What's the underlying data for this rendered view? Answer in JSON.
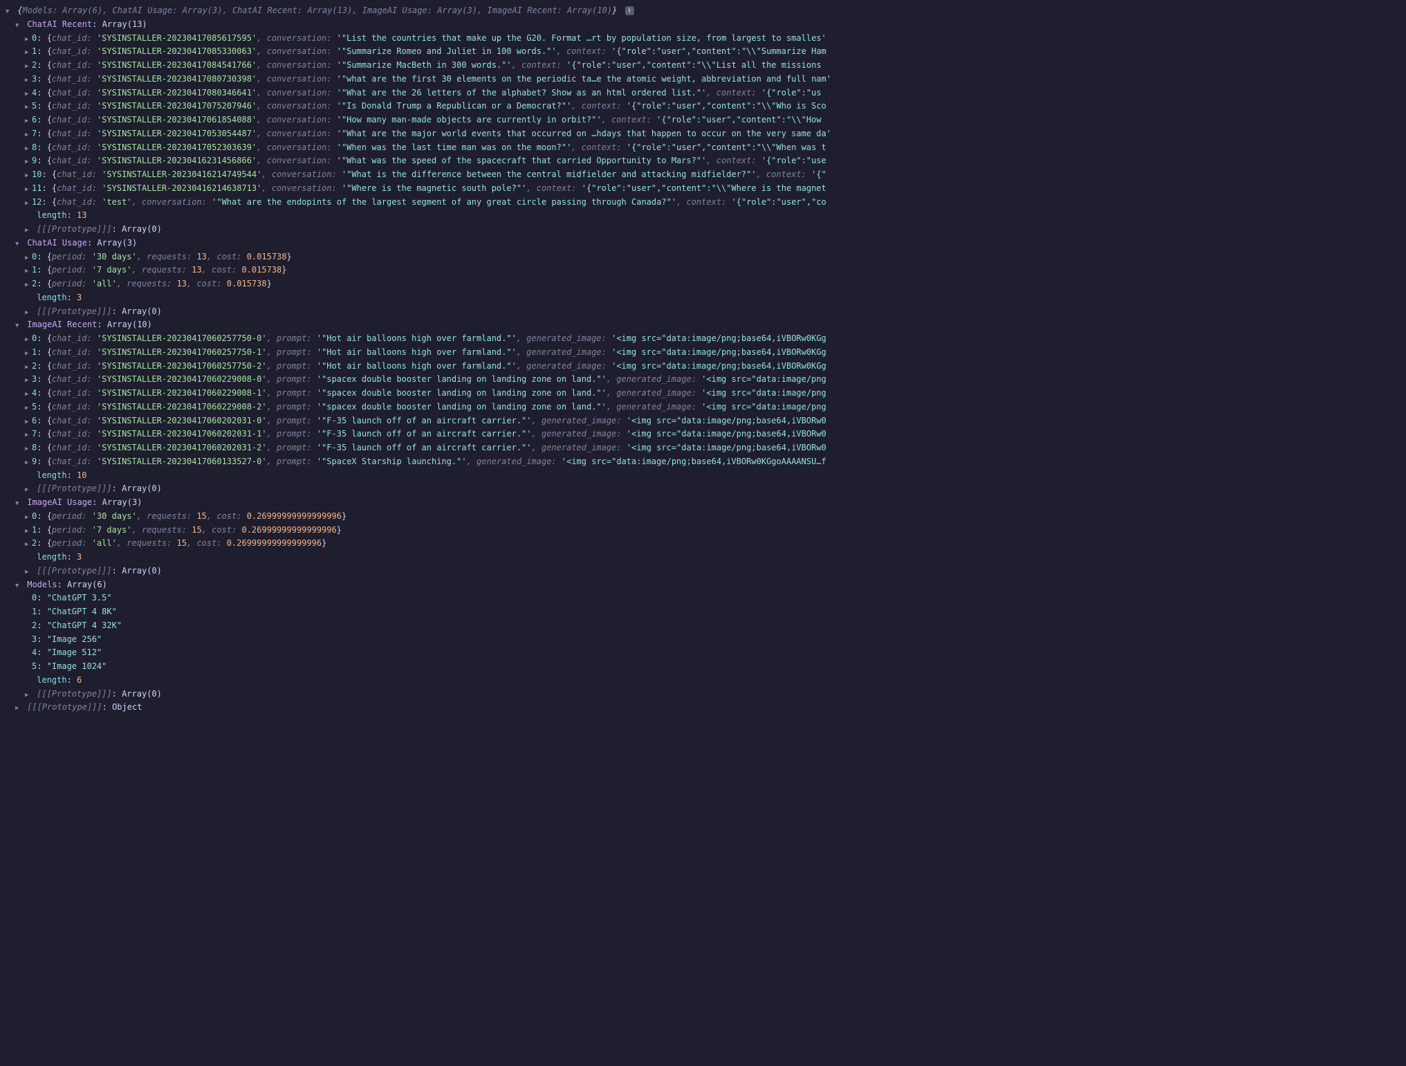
{
  "root_summary": {
    "keys": [
      {
        "k": "Models",
        "v": "Array(6)"
      },
      {
        "k": "ChatAI Usage",
        "v": "Array(3)"
      },
      {
        "k": "ChatAI Recent",
        "v": "Array(13)"
      },
      {
        "k": "ImageAI Usage",
        "v": "Array(3)"
      },
      {
        "k": "ImageAI Recent",
        "v": "Array(10)"
      }
    ]
  },
  "sections": {
    "chat_recent": {
      "title": "ChatAI Recent",
      "len": 13,
      "proto": "Array(0)"
    },
    "chat_usage": {
      "title": "ChatAI Usage",
      "len": 3,
      "proto": "Array(0)"
    },
    "img_recent": {
      "title": "ImageAI Recent",
      "len": 10,
      "proto": "Array(0)"
    },
    "img_usage": {
      "title": "ImageAI Usage",
      "len": 3,
      "proto": "Array(0)"
    },
    "models": {
      "title": "Models",
      "len": 6,
      "proto": "Array(0)"
    },
    "root_proto": "Object"
  },
  "chat_recent": [
    {
      "id": "SYSINSTALLER-20230417085617595",
      "conv": "\"List the countries that make up the G20.  Format …rt by population size, from largest to smalles",
      "ctx": ""
    },
    {
      "id": "SYSINSTALLER-20230417085330063",
      "conv": "\"Summarize Romeo and Juliet in 100 words.\"",
      "ctx": "'{\"role\":\"user\",\"content\":\"\\\\\"Summarize Ham"
    },
    {
      "id": "SYSINSTALLER-20230417084541766",
      "conv": "\"Summarize MacBeth in 300 words.\"",
      "ctx": "'{\"role\":\"user\",\"content\":\"\\\\\"List all the missions"
    },
    {
      "id": "SYSINSTALLER-20230417080730398",
      "conv": "\"what are the first 30 elements on the periodic ta…e the atomic weight, abbreviation and full nam",
      "ctx": ""
    },
    {
      "id": "SYSINSTALLER-20230417080346641",
      "conv": "\"What are the 26 letters of the alphabet?  Show as an html ordered list.\"",
      "ctx": "'{\"role\":\"us"
    },
    {
      "id": "SYSINSTALLER-20230417075207946",
      "conv": "\"Is Donald Trump a Republican or a Democrat?\"",
      "ctx": "'{\"role\":\"user\",\"content\":\"\\\\\"Who is Sco"
    },
    {
      "id": "SYSINSTALLER-20230417061854088",
      "conv": "\"How many man-made objects are currently in orbit?\"",
      "ctx": "'{\"role\":\"user\",\"content\":\"\\\\\"How"
    },
    {
      "id": "SYSINSTALLER-20230417053054487",
      "conv": "\"What are the major world events that occurred on …hdays that happen to occur on the very same da",
      "ctx": ""
    },
    {
      "id": "SYSINSTALLER-20230417052303639",
      "conv": "\"When was the last time man was on the moon?\"",
      "ctx": "'{\"role\":\"user\",\"content\":\"\\\\\"When was t"
    },
    {
      "id": "SYSINSTALLER-20230416231456866",
      "conv": "\"What was the speed of the spacecraft that carried Opportunity to Mars?\"",
      "ctx": "'{\"role\":\"use"
    },
    {
      "id": "SYSINSTALLER-20230416214749544",
      "conv": "\"What is the difference between the central midfielder and attacking midfielder?\"",
      "ctx": "'{\""
    },
    {
      "id": "SYSINSTALLER-20230416214638713",
      "conv": "\"Where is the magnetic south pole?\"",
      "ctx": "'{\"role\":\"user\",\"content\":\"\\\\\"Where is the magnet"
    },
    {
      "id": "test",
      "conv": "\"What are the endopints of the largest segment of any great circle passing through Canada?\"",
      "ctx": "'{\"role\":\"user\",\"co"
    }
  ],
  "chat_usage": [
    {
      "period": "30 days",
      "requests": 13,
      "cost": "0.015738"
    },
    {
      "period": "7 days",
      "requests": 13,
      "cost": "0.015738"
    },
    {
      "period": "all",
      "requests": 13,
      "cost": "0.015738"
    }
  ],
  "img_recent": [
    {
      "id": "SYSINSTALLER-20230417060257750-0",
      "prompt": "\"Hot air balloons high over farmland.\"",
      "gen": "'<img src=\"data:image/png;base64,iVBORw0KGg"
    },
    {
      "id": "SYSINSTALLER-20230417060257750-1",
      "prompt": "\"Hot air balloons high over farmland.\"",
      "gen": "'<img src=\"data:image/png;base64,iVBORw0KGg"
    },
    {
      "id": "SYSINSTALLER-20230417060257750-2",
      "prompt": "\"Hot air balloons high over farmland.\"",
      "gen": "'<img src=\"data:image/png;base64,iVBORw0KGg"
    },
    {
      "id": "SYSINSTALLER-20230417060229008-0",
      "prompt": "\"spacex double booster landing on landing zone on land.\"",
      "gen": "'<img src=\"data:image/png"
    },
    {
      "id": "SYSINSTALLER-20230417060229008-1",
      "prompt": "\"spacex double booster landing on landing zone on land.\"",
      "gen": "'<img src=\"data:image/png"
    },
    {
      "id": "SYSINSTALLER-20230417060229008-2",
      "prompt": "\"spacex double booster landing on landing zone on land.\"",
      "gen": "'<img src=\"data:image/png"
    },
    {
      "id": "SYSINSTALLER-20230417060202031-0",
      "prompt": "\"F-35 launch off of an aircraft carrier.\"",
      "gen": "'<img src=\"data:image/png;base64,iVBORw0"
    },
    {
      "id": "SYSINSTALLER-20230417060202031-1",
      "prompt": "\"F-35 launch off of an aircraft carrier.\"",
      "gen": "'<img src=\"data:image/png;base64,iVBORw0"
    },
    {
      "id": "SYSINSTALLER-20230417060202031-2",
      "prompt": "\"F-35 launch off of an aircraft carrier.\"",
      "gen": "'<img src=\"data:image/png;base64,iVBORw0"
    },
    {
      "id": "SYSINSTALLER-20230417060133527-0",
      "prompt": "\"SpaceX Starship launching.\"",
      "gen": "'<img src=\"data:image/png;base64,iVBORw0KGgoAAAANSU…f"
    }
  ],
  "img_usage": [
    {
      "period": "30 days",
      "requests": 15,
      "cost": "0.26999999999999996"
    },
    {
      "period": "7 days",
      "requests": 15,
      "cost": "0.26999999999999996"
    },
    {
      "period": "all",
      "requests": 15,
      "cost": "0.26999999999999996"
    }
  ],
  "models": [
    "ChatGPT 3.5",
    "ChatGPT 4 8K",
    "ChatGPT 4 32K",
    "Image 256",
    "Image 512",
    "Image 1024"
  ],
  "labels": {
    "length": "length",
    "proto": "[[Prototype]]",
    "chat_id": "chat_id",
    "conversation": "conversation",
    "context": "context",
    "period": "period",
    "requests": "requests",
    "cost": "cost",
    "prompt": "prompt",
    "generated_image": "generated_image",
    "Array": "Array"
  }
}
